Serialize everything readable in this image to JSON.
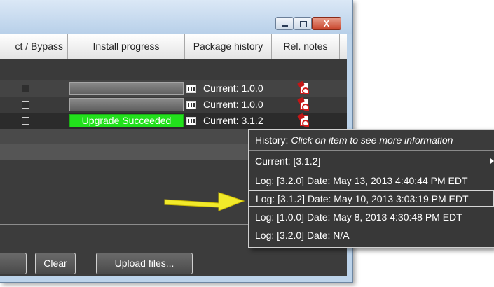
{
  "columns": {
    "connect_bypass": "ct / Bypass",
    "install_progress": "Install progress",
    "package_history": "Package history",
    "rel_notes": "Rel. notes"
  },
  "rows": [
    {
      "progress_text": "",
      "progress": 0,
      "current": "Current: 1.0.0"
    },
    {
      "progress_text": "",
      "progress": 0,
      "current": "Current: 1.0.0"
    },
    {
      "progress_text": "Upgrade Succeeded",
      "progress": 1,
      "current": "Current: 3.1.2"
    }
  ],
  "buttons": {
    "clear": "Clear",
    "upload": "Upload files..."
  },
  "window_controls": {
    "close_glyph": "X"
  },
  "history_menu": {
    "title_prefix": "History:",
    "title_hint": "Click on item to see more information",
    "items": [
      "Current: [3.1.2]",
      "Log: [3.2.0] Date: May 13, 2013 4:40:44 PM EDT",
      "Log: [3.1.2] Date: May 10, 2013 3:03:19 PM EDT",
      "Log: [1.0.0] Date: May 8, 2013 4:30:48 PM EDT",
      "Log: [3.2.0] Date: N/A"
    ]
  },
  "colors": {
    "success": "#22e11c",
    "arrow": "#f2ea2a",
    "pdf_red": "#c31616"
  }
}
